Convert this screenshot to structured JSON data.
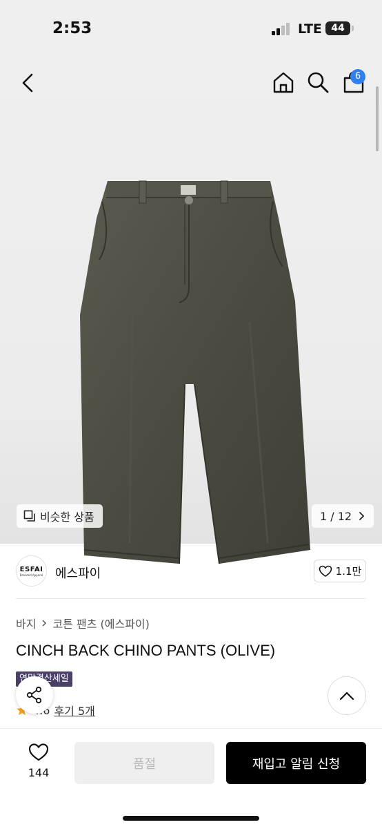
{
  "status_bar": {
    "time": "2:53",
    "network": "LTE",
    "battery": "44"
  },
  "header": {
    "cart_count": "6"
  },
  "gallery": {
    "similar_label": "비슷한 상품",
    "pager": "1 / 12"
  },
  "brand": {
    "logo_text": "ESFAI",
    "logo_sub": "Branded Apparel",
    "name": "에스파이",
    "likes": "1.1만"
  },
  "breadcrumb": [
    "바지",
    "코튼 팬츠 (에스파이)"
  ],
  "product": {
    "title": "CINCH BACK CHINO PANTS (OLIVE)",
    "badge": "연말결산세일",
    "rating": "4.6",
    "reviews": "후기 5개"
  },
  "bottom_bar": {
    "wish_count": "144",
    "soldout_label": "품절",
    "restock_label": "재입고 알림 신청"
  },
  "colors": {
    "accent_blue": "#2f80ed",
    "badge_purple": "#4a3f67",
    "primary_black": "#000000"
  },
  "icons": [
    "back-icon",
    "home-icon",
    "search-icon",
    "cart-icon",
    "similar-icon",
    "chevron-right-icon",
    "heart-icon",
    "share-icon",
    "chevron-up-icon",
    "star-icon"
  ]
}
